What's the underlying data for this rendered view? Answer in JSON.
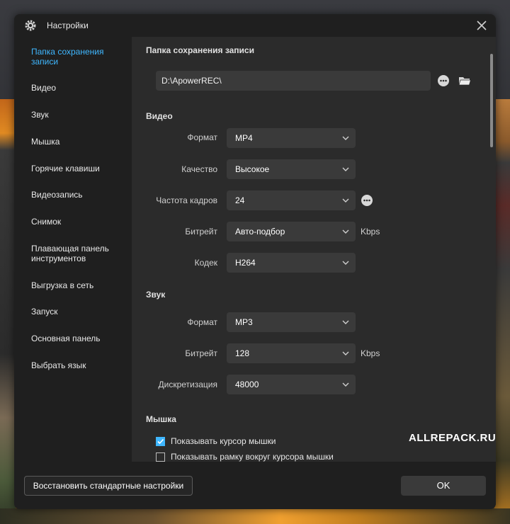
{
  "window": {
    "title": "Настройки"
  },
  "sidebar": {
    "items": [
      {
        "label": "Папка сохранения записи",
        "active": true
      },
      {
        "label": "Видео"
      },
      {
        "label": "Звук"
      },
      {
        "label": "Мышка"
      },
      {
        "label": "Горячие клавиши"
      },
      {
        "label": "Видеозапись"
      },
      {
        "label": "Снимок"
      },
      {
        "label": "Плавающая панель инструментов"
      },
      {
        "label": "Выгрузка в сеть"
      },
      {
        "label": "Запуск"
      },
      {
        "label": "Основная панель"
      },
      {
        "label": "Выбрать язык"
      }
    ]
  },
  "save_folder": {
    "title": "Папка сохранения записи",
    "path": "D:\\ApowerREC\\"
  },
  "video": {
    "title": "Видео",
    "format_label": "Формат",
    "format_value": "MP4",
    "quality_label": "Качество",
    "quality_value": "Высокое",
    "fps_label": "Частота кадров",
    "fps_value": "24",
    "bitrate_label": "Битрейт",
    "bitrate_value": "Авто-подбор",
    "bitrate_unit": "Kbps",
    "codec_label": "Кодек",
    "codec_value": "H264"
  },
  "audio": {
    "title": "Звук",
    "format_label": "Формат",
    "format_value": "MP3",
    "bitrate_label": "Битрейт",
    "bitrate_value": "128",
    "bitrate_unit": "Kbps",
    "sampling_label": "Дискретизация",
    "sampling_value": "48000"
  },
  "mouse": {
    "title": "Мышка",
    "show_cursor_label": "Показывать курсор мышки",
    "show_cursor_checked": true,
    "show_frame_label": "Показывать рамку вокруг курсора мышки",
    "show_frame_checked": false
  },
  "watermark": "ALLREPACK.RU",
  "footer": {
    "reset_label": "Восстановить стандартные настройки",
    "ok_label": "OK"
  },
  "colors": {
    "accent": "#3fb7ff",
    "panel": "#2b2b2b",
    "sidebar": "#1f1f1f",
    "field": "#3a3a3a"
  },
  "icons": {
    "settings": "gear-icon",
    "close": "close-icon",
    "more": "more-options-icon",
    "folder": "folder-icon",
    "chevron": "chevron-down-icon"
  }
}
